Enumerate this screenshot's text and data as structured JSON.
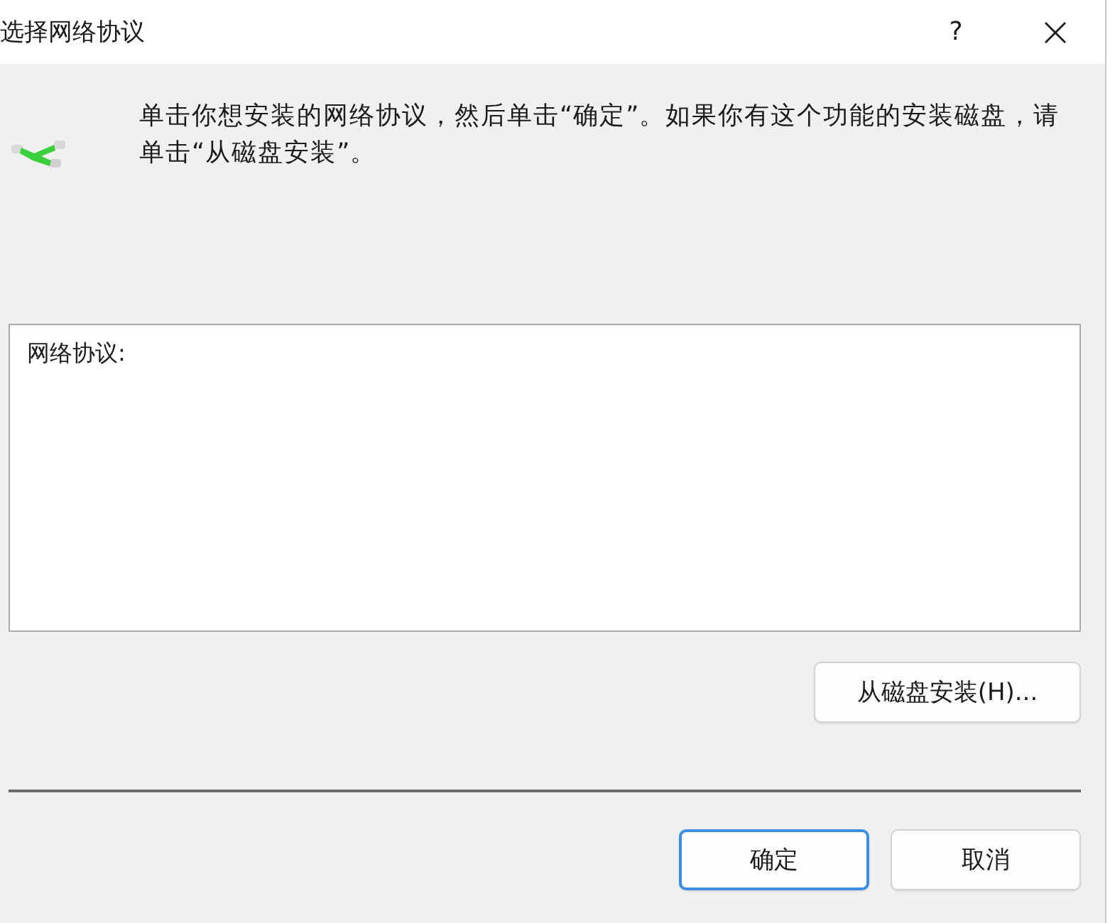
{
  "window": {
    "title": "选择网络协议",
    "help_button": "?"
  },
  "instruction": "单击你想安装的网络协议，然后单击“确定”。如果你有这个功能的安装磁盘，请单击“从磁盘安装”。",
  "protocol_list": {
    "label": "网络协议:"
  },
  "install_from_disk_button": "从磁盘安装(H)...",
  "buttons": [
    {
      "label": "确定",
      "default": true
    },
    {
      "label": "取消",
      "default": false
    }
  ]
}
